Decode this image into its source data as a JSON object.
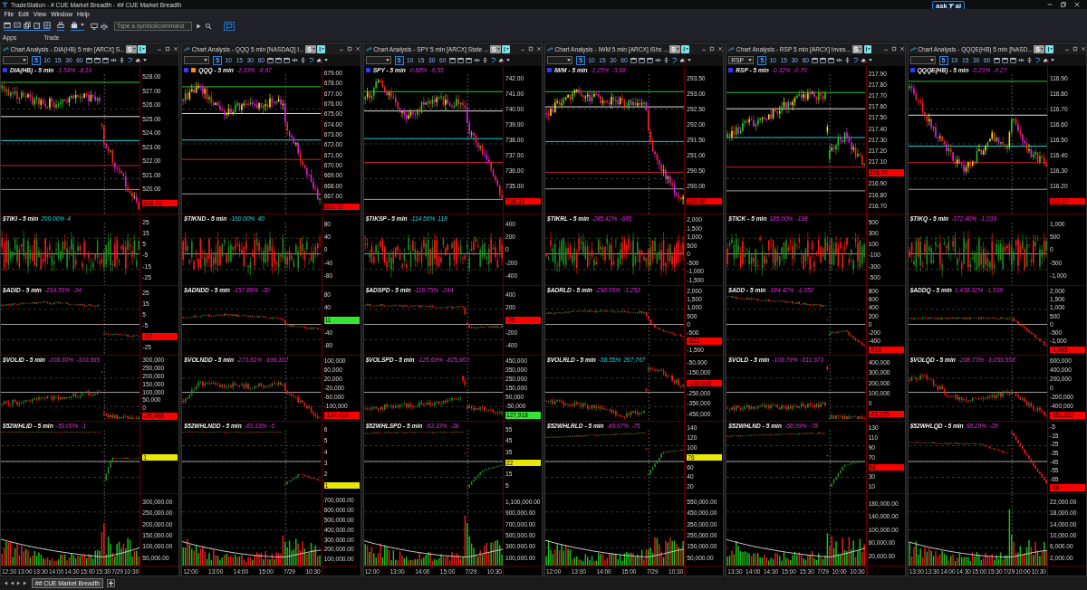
{
  "window": {
    "title": "TradeStation - # CUE Market Breadth - ## CUE Market Breadth"
  },
  "ask_ai": {
    "before": "ask",
    "after": "ai"
  },
  "menu": [
    "File",
    "Edit",
    "View",
    "Window",
    "Help"
  ],
  "toolbar": {
    "command_field": {
      "placeholder": "Type a symbol/command"
    }
  },
  "sections": [
    "Apps",
    "Trade"
  ],
  "panels": [
    {
      "title": "Chart Analysis - DIA(HB) 5 min [ARCX] S...",
      "mode_buttons": [
        {
          "label": "S",
          "active": false
        },
        {
          "label": "I",
          "active": true
        }
      ],
      "intervals": [
        {
          "label": "5",
          "selected": true
        },
        {
          "label": "10",
          "selected": false
        },
        {
          "label": "15",
          "selected": false
        },
        {
          "label": "30",
          "selected": false
        },
        {
          "label": "60",
          "selected": false
        }
      ],
      "panes": [
        {
          "kind": "price",
          "label": "DIA(HB) - 5 min",
          "percent": "-1.54%",
          "change": "-8.10",
          "rising": false,
          "tags": [
            {
              "color": "#2b3bff"
            }
          ],
          "axis": [
            {
              "kind": "tick",
              "text": "528.00"
            },
            {
              "kind": "tick",
              "text": "527.00"
            },
            {
              "kind": "tick",
              "text": "526.00"
            },
            {
              "kind": "tick",
              "text": "525.00"
            },
            {
              "kind": "tick",
              "text": "524.00"
            },
            {
              "kind": "tick",
              "text": "523.00"
            },
            {
              "kind": "tick",
              "text": "522.00"
            },
            {
              "kind": "tick",
              "text": "521.00"
            },
            {
              "kind": "tick",
              "text": "520.00"
            },
            {
              "kind": "marker",
              "text": "518.79",
              "color": "#ff0000"
            }
          ]
        },
        {
          "kind": "tick",
          "label": "$TIKI - 5 min",
          "percent": "200.00%",
          "change": "4",
          "rising": true,
          "axis": [
            {
              "kind": "tick",
              "text": "25"
            },
            {
              "kind": "tick",
              "text": "15"
            },
            {
              "kind": "tick",
              "text": "5"
            },
            {
              "kind": "tick",
              "text": "-5"
            },
            {
              "kind": "tick",
              "text": "-15"
            },
            {
              "kind": "tick",
              "text": "-25"
            }
          ]
        },
        {
          "kind": "breadth",
          "label": "$ADID - 5 min",
          "percent": "-154.55%",
          "change": "-34",
          "rising": false,
          "axis": [
            {
              "kind": "tick",
              "text": "25"
            },
            {
              "kind": "tick",
              "text": "15"
            },
            {
              "kind": "tick",
              "text": "5"
            },
            {
              "kind": "tick",
              "text": "-5"
            },
            {
              "kind": "marker",
              "text": "-12",
              "color": "#ff0000"
            },
            {
              "kind": "tick",
              "text": "-25"
            }
          ]
        },
        {
          "kind": "volume_diff",
          "label": "$VOLID - 5 min",
          "percent": "-108.60%",
          "change": "-333,695",
          "rising": false,
          "axis": [
            {
              "kind": "tick",
              "text": "300,000"
            },
            {
              "kind": "tick",
              "text": "250,000"
            },
            {
              "kind": "tick",
              "text": "200,000"
            },
            {
              "kind": "tick",
              "text": "150,000"
            },
            {
              "kind": "tick",
              "text": "100,000"
            },
            {
              "kind": "tick",
              "text": "50,000"
            },
            {
              "kind": "tick",
              "text": "0"
            },
            {
              "kind": "marker",
              "text": "-20,438",
              "color": "#ff0000"
            }
          ]
        },
        {
          "kind": "highs_lows",
          "label": "$52WHLID - 5 min",
          "percent": "-50.00%",
          "change": "-1",
          "rising": false,
          "axis": [
            {
              "kind": "marker",
              "text": "1",
              "color": "#e8e800"
            }
          ]
        },
        {
          "kind": "volume",
          "axis": [
            {
              "kind": "tick",
              "text": "300,000.00"
            },
            {
              "kind": "tick",
              "text": "250,000.00"
            },
            {
              "kind": "tick",
              "text": "200,000.00"
            },
            {
              "kind": "tick",
              "text": "150,000.00"
            },
            {
              "kind": "tick",
              "text": "100,000.00"
            },
            {
              "kind": "tick",
              "text": "50,000.00"
            }
          ]
        }
      ],
      "time_axis": [
        "12:30",
        "13:00",
        "13:30",
        "14:00",
        "14:30",
        "15:00",
        "15:30",
        "7/29",
        "10:30"
      ]
    },
    {
      "title": "Chart Analysis - QQQ 5 min [NASDAQ] I...",
      "mode_buttons": [
        {
          "label": "S",
          "active": false
        },
        {
          "label": "I",
          "active": true
        }
      ],
      "intervals": [
        {
          "label": "5",
          "selected": true
        },
        {
          "label": "10",
          "selected": false
        },
        {
          "label": "15",
          "selected": false
        },
        {
          "label": "30",
          "selected": false
        },
        {
          "label": "60",
          "selected": false
        }
      ],
      "panes": [
        {
          "kind": "price",
          "label": "QQQ - 5 min",
          "percent": "-1.33%",
          "change": "-8.97",
          "rising": false,
          "tags": [
            {
              "color": "#2b3bff"
            },
            {
              "color": "#ff8a00"
            }
          ],
          "axis": [
            {
              "kind": "tick",
              "text": "679.00"
            },
            {
              "kind": "tick",
              "text": "678.00"
            },
            {
              "kind": "tick",
              "text": "677.00"
            },
            {
              "kind": "tick",
              "text": "676.00"
            },
            {
              "kind": "tick",
              "text": "675.00"
            },
            {
              "kind": "tick",
              "text": "674.00"
            },
            {
              "kind": "tick",
              "text": "673.00"
            },
            {
              "kind": "tick",
              "text": "672.00"
            },
            {
              "kind": "tick",
              "text": "671.00"
            },
            {
              "kind": "tick",
              "text": "670.00"
            },
            {
              "kind": "tick",
              "text": "669.00"
            },
            {
              "kind": "tick",
              "text": "668.00"
            },
            {
              "kind": "tick",
              "text": "667.00"
            },
            {
              "kind": "marker",
              "text": "666.55",
              "color": "#ff0000"
            }
          ]
        },
        {
          "kind": "tick",
          "label": "$TIKND - 5 min",
          "percent": "-160.00%",
          "change": "40",
          "rising": true,
          "axis": [
            {
              "kind": "tick",
              "text": "80"
            },
            {
              "kind": "tick",
              "text": "40"
            },
            {
              "kind": "tick",
              "text": "0"
            },
            {
              "kind": "tick",
              "text": "-40"
            },
            {
              "kind": "tick",
              "text": "-80"
            }
          ]
        },
        {
          "kind": "breadth",
          "label": "$ADNDD - 5 min",
          "percent": "-157.89%",
          "change": "-30",
          "rising": false,
          "axis": [
            {
              "kind": "tick",
              "text": "80"
            },
            {
              "kind": "tick",
              "text": "40"
            },
            {
              "kind": "marker",
              "text": "11",
              "color": "#33e633"
            },
            {
              "kind": "tick",
              "text": "-40"
            },
            {
              "kind": "tick",
              "text": "-80"
            }
          ]
        },
        {
          "kind": "volume_diff",
          "label": "$VOLNDD - 5 min",
          "percent": "-273.61%",
          "change": "-196,102",
          "rising": false,
          "axis": [
            {
              "kind": "tick",
              "text": "100,000"
            },
            {
              "kind": "tick",
              "text": "60,000"
            },
            {
              "kind": "tick",
              "text": "20,000"
            },
            {
              "kind": "tick",
              "text": "-20,000"
            },
            {
              "kind": "tick",
              "text": "-60,000"
            },
            {
              "kind": "tick",
              "text": "-100,000"
            },
            {
              "kind": "marker",
              "text": "-124,418",
              "color": "#ff0000"
            }
          ]
        },
        {
          "kind": "highs_lows",
          "label": "$52WHLNDD - 5 min",
          "percent": "-83.33%",
          "change": "-5",
          "rising": false,
          "axis": [
            {
              "kind": "tick",
              "text": "6"
            },
            {
              "kind": "tick",
              "text": "5"
            },
            {
              "kind": "tick",
              "text": "4"
            },
            {
              "kind": "tick",
              "text": "3"
            },
            {
              "kind": "tick",
              "text": "2"
            },
            {
              "kind": "marker",
              "text": "1",
              "color": "#e8e800"
            }
          ]
        },
        {
          "kind": "volume",
          "axis": [
            {
              "kind": "tick",
              "text": "700,000.00"
            },
            {
              "kind": "tick",
              "text": "600,000.00"
            },
            {
              "kind": "tick",
              "text": "500,000.00"
            },
            {
              "kind": "tick",
              "text": "400,000.00"
            },
            {
              "kind": "tick",
              "text": "300,000.00"
            },
            {
              "kind": "tick",
              "text": "200,000.00"
            },
            {
              "kind": "tick",
              "text": "100,000.00"
            }
          ]
        }
      ],
      "time_axis": [
        "12:00",
        "13:00",
        "14:00",
        "15:00",
        "7/29",
        "10:30"
      ]
    },
    {
      "title": "Chart Analysis - SPY 5 min [ARCX] State ...",
      "mode_buttons": [
        {
          "label": "S",
          "active": false
        },
        {
          "label": "I",
          "active": true
        }
      ],
      "intervals": [
        {
          "label": "5",
          "selected": true
        },
        {
          "label": "10",
          "selected": false
        },
        {
          "label": "15",
          "selected": false
        },
        {
          "label": "30",
          "selected": false
        },
        {
          "label": "60",
          "selected": false
        }
      ],
      "panes": [
        {
          "kind": "price",
          "label": "SPY - 5 min",
          "percent": "-0.88%",
          "change": "-6.55",
          "rising": false,
          "tags": [
            {
              "color": "#2b3bff"
            }
          ],
          "axis": [
            {
              "kind": "tick",
              "text": "742.00"
            },
            {
              "kind": "tick",
              "text": "741.00"
            },
            {
              "kind": "tick",
              "text": "740.00"
            },
            {
              "kind": "tick",
              "text": "739.00"
            },
            {
              "kind": "tick",
              "text": "738.00"
            },
            {
              "kind": "tick",
              "text": "737.00"
            },
            {
              "kind": "tick",
              "text": "736.00"
            },
            {
              "kind": "tick",
              "text": "735.00"
            },
            {
              "kind": "marker",
              "text": "734.31",
              "color": "#ff0000"
            }
          ]
        },
        {
          "kind": "tick",
          "label": "$TIKSP - 5 min",
          "percent": "-114.56%",
          "change": "118",
          "rising": true,
          "axis": [
            {
              "kind": "tick",
              "text": "400"
            },
            {
              "kind": "tick",
              "text": "200"
            },
            {
              "kind": "tick",
              "text": "0"
            },
            {
              "kind": "tick",
              "text": "-200"
            },
            {
              "kind": "tick",
              "text": "-400"
            }
          ]
        },
        {
          "kind": "breadth",
          "label": "$ADSPD - 5 min",
          "percent": "-116.75%",
          "change": "-244",
          "rising": false,
          "axis": [
            {
              "kind": "tick",
              "text": "400"
            },
            {
              "kind": "tick",
              "text": "200"
            },
            {
              "kind": "marker",
              "text": "-35",
              "color": "#ff0000"
            },
            {
              "kind": "tick",
              "text": "-200"
            },
            {
              "kind": "tick",
              "text": "-400"
            }
          ]
        },
        {
          "kind": "volume_diff",
          "label": "$VOLSPD - 5 min",
          "percent": "-125.69%",
          "change": "-825,903",
          "rising": false,
          "axis": [
            {
              "kind": "tick",
              "text": "450,000"
            },
            {
              "kind": "tick",
              "text": "350,000"
            },
            {
              "kind": "tick",
              "text": "250,000"
            },
            {
              "kind": "tick",
              "text": "150,000"
            },
            {
              "kind": "tick",
              "text": "50,000"
            },
            {
              "kind": "tick",
              "text": "-50,000"
            },
            {
              "kind": "marker",
              "text": "127,918",
              "color": "#33e633"
            }
          ]
        },
        {
          "kind": "highs_lows",
          "label": "$52WHLSPD - 5 min",
          "percent": "-63.33%",
          "change": "-38",
          "rising": false,
          "axis": [
            {
              "kind": "tick",
              "text": "55"
            },
            {
              "kind": "tick",
              "text": "45"
            },
            {
              "kind": "tick",
              "text": "35"
            },
            {
              "kind": "marker",
              "text": "22",
              "color": "#e8e800"
            },
            {
              "kind": "tick",
              "text": "15"
            },
            {
              "kind": "tick",
              "text": "5"
            }
          ]
        },
        {
          "kind": "volume",
          "axis": [
            {
              "kind": "tick",
              "text": "1,100,000.00"
            },
            {
              "kind": "tick",
              "text": "900,000.00"
            },
            {
              "kind": "tick",
              "text": "700,000.00"
            },
            {
              "kind": "tick",
              "text": "500,000.00"
            },
            {
              "kind": "tick",
              "text": "300,000.00"
            },
            {
              "kind": "tick",
              "text": "100,000.00"
            }
          ]
        }
      ],
      "time_axis": [
        "12:00",
        "13:00",
        "14:00",
        "15:00",
        "7/29",
        "10:30"
      ]
    },
    {
      "title": "Chart Analysis - IWM 5 min [ARCX] iShs ...",
      "mode_buttons": [
        {
          "label": "S",
          "active": false
        },
        {
          "label": "I",
          "active": true
        }
      ],
      "intervals": [
        {
          "label": "5",
          "selected": true
        },
        {
          "label": "10",
          "selected": false
        },
        {
          "label": "15",
          "selected": false
        },
        {
          "label": "30",
          "selected": false
        },
        {
          "label": "60",
          "selected": false
        }
      ],
      "panes": [
        {
          "kind": "price",
          "label": "IWM - 5 min",
          "percent": "-1.25%",
          "change": "-3.68",
          "rising": false,
          "tags": [
            {
              "color": "#2b3bff"
            }
          ],
          "axis": [
            {
              "kind": "tick",
              "text": "293.50"
            },
            {
              "kind": "tick",
              "text": "293.00"
            },
            {
              "kind": "tick",
              "text": "292.50"
            },
            {
              "kind": "tick",
              "text": "292.00"
            },
            {
              "kind": "tick",
              "text": "291.50"
            },
            {
              "kind": "tick",
              "text": "291.00"
            },
            {
              "kind": "tick",
              "text": "290.50"
            },
            {
              "kind": "tick",
              "text": "290.00"
            },
            {
              "kind": "marker",
              "text": "289.89",
              "color": "#ff0000"
            }
          ]
        },
        {
          "kind": "tick",
          "label": "$TIKRL - 5 min",
          "percent": "-285.42%",
          "change": "-685",
          "rising": false,
          "axis": [
            {
              "kind": "tick",
              "text": "2,000"
            },
            {
              "kind": "tick",
              "text": "1,500"
            },
            {
              "kind": "tick",
              "text": "1,000"
            },
            {
              "kind": "tick",
              "text": "500"
            },
            {
              "kind": "tick",
              "text": "0"
            },
            {
              "kind": "tick",
              "text": "-500"
            },
            {
              "kind": "tick",
              "text": "-1,000"
            },
            {
              "kind": "tick",
              "text": "-1,500"
            }
          ]
        },
        {
          "kind": "breadth",
          "label": "$ADRLD - 5 min",
          "percent": "-290.05%",
          "change": "-1,253",
          "rising": false,
          "axis": [
            {
              "kind": "tick",
              "text": "2,000"
            },
            {
              "kind": "tick",
              "text": "1,500"
            },
            {
              "kind": "tick",
              "text": "1,000"
            },
            {
              "kind": "tick",
              "text": "500"
            },
            {
              "kind": "tick",
              "text": "0"
            },
            {
              "kind": "tick",
              "text": "-500"
            },
            {
              "kind": "marker",
              "text": "-821",
              "color": "#ff0000"
            },
            {
              "kind": "tick",
              "text": "-1,500"
            }
          ]
        },
        {
          "kind": "volume_diff",
          "label": "$VOLRLD - 5 min",
          "percent": "-58.55%",
          "change": "267,767",
          "rising": true,
          "axis": [
            {
              "kind": "tick",
              "text": "-50,000"
            },
            {
              "kind": "tick",
              "text": "-150,000"
            },
            {
              "kind": "marker",
              "text": "-180,505",
              "color": "#ff0000"
            },
            {
              "kind": "tick",
              "text": "-250,000"
            },
            {
              "kind": "tick",
              "text": "-350,000"
            },
            {
              "kind": "tick",
              "text": "-450,000"
            }
          ]
        },
        {
          "kind": "highs_lows",
          "label": "$52WHLRLD - 5 min",
          "percent": "-49.67%",
          "change": "-75",
          "rising": false,
          "axis": [
            {
              "kind": "tick",
              "text": "140"
            },
            {
              "kind": "tick",
              "text": "120"
            },
            {
              "kind": "tick",
              "text": "100"
            },
            {
              "kind": "marker",
              "text": "76",
              "color": "#e8e800"
            },
            {
              "kind": "tick",
              "text": "60"
            },
            {
              "kind": "tick",
              "text": "40"
            },
            {
              "kind": "tick",
              "text": "20"
            }
          ]
        },
        {
          "kind": "volume",
          "axis": [
            {
              "kind": "tick",
              "text": "550,000.00"
            },
            {
              "kind": "tick",
              "text": "450,000.00"
            },
            {
              "kind": "tick",
              "text": "350,000.00"
            },
            {
              "kind": "tick",
              "text": "250,000.00"
            },
            {
              "kind": "tick",
              "text": "150,000.00"
            },
            {
              "kind": "tick",
              "text": "50,000.00"
            }
          ]
        }
      ],
      "time_axis": [
        "12:00",
        "13:00",
        "14:00",
        "15:00",
        "7/29",
        "10:30"
      ]
    },
    {
      "title": "Chart Analysis - RSP 5 min [ARCX] Inves...",
      "symbol_dropdown": {
        "value": "RSP"
      },
      "mode_buttons": [
        {
          "label": "S",
          "active": false
        },
        {
          "label": "I",
          "active": true
        }
      ],
      "intervals": [
        {
          "label": "5",
          "selected": true
        },
        {
          "label": "10",
          "selected": false
        },
        {
          "label": "15",
          "selected": false
        },
        {
          "label": "30",
          "selected": false
        },
        {
          "label": "60",
          "selected": false
        }
      ],
      "panes": [
        {
          "kind": "price",
          "label": "RSP - 5 min",
          "percent": "-0.32%",
          "change": "-0.70",
          "rising": false,
          "tags": [
            {
              "color": "#2b3bff"
            }
          ],
          "axis": [
            {
              "kind": "tick",
              "text": "217.90"
            },
            {
              "kind": "tick",
              "text": "217.80"
            },
            {
              "kind": "tick",
              "text": "217.70"
            },
            {
              "kind": "tick",
              "text": "217.60"
            },
            {
              "kind": "tick",
              "text": "217.50"
            },
            {
              "kind": "tick",
              "text": "217.40"
            },
            {
              "kind": "tick",
              "text": "217.30"
            },
            {
              "kind": "tick",
              "text": "217.20"
            },
            {
              "kind": "tick",
              "text": "217.10"
            },
            {
              "kind": "marker",
              "text": "216.95",
              "color": "#ff0000"
            },
            {
              "kind": "tick",
              "text": "216.90"
            },
            {
              "kind": "tick",
              "text": "216.80"
            },
            {
              "kind": "tick",
              "text": "216.70"
            }
          ]
        },
        {
          "kind": "tick",
          "label": "$TICK - 5 min",
          "percent": "185.00%",
          "change": "-198",
          "rising": false,
          "axis": [
            {
              "kind": "tick",
              "text": "500"
            },
            {
              "kind": "tick",
              "text": "300"
            },
            {
              "kind": "tick",
              "text": "100"
            },
            {
              "kind": "tick",
              "text": "-100"
            },
            {
              "kind": "tick",
              "text": "-300"
            },
            {
              "kind": "tick",
              "text": "-500"
            }
          ]
        },
        {
          "kind": "breadth",
          "label": "$ADD - 5 min",
          "percent": "-184.42%",
          "change": "-1,350",
          "rising": false,
          "axis": [
            {
              "kind": "tick",
              "text": "800"
            },
            {
              "kind": "tick",
              "text": "600"
            },
            {
              "kind": "tick",
              "text": "400"
            },
            {
              "kind": "tick",
              "text": "200"
            },
            {
              "kind": "tick",
              "text": "0"
            },
            {
              "kind": "tick",
              "text": "-200"
            },
            {
              "kind": "tick",
              "text": "-400"
            },
            {
              "kind": "marker",
              "text": "-518",
              "color": "#ff0000"
            }
          ]
        },
        {
          "kind": "volume_diff",
          "label": "$VOLD - 5 min",
          "percent": "-108.79%",
          "change": "-511,673",
          "rising": false,
          "axis": [
            {
              "kind": "tick",
              "text": "400,000"
            },
            {
              "kind": "tick",
              "text": "300,000"
            },
            {
              "kind": "tick",
              "text": "200,000"
            },
            {
              "kind": "tick",
              "text": "100,000"
            },
            {
              "kind": "tick",
              "text": "0"
            },
            {
              "kind": "marker",
              "text": "-41,129",
              "color": "#ff0000"
            }
          ]
        },
        {
          "kind": "highs_lows",
          "label": "$52WHLND - 5 min",
          "percent": "-58.09%",
          "change": "-78",
          "rising": false,
          "axis": [
            {
              "kind": "tick",
              "text": "130"
            },
            {
              "kind": "tick",
              "text": "110"
            },
            {
              "kind": "tick",
              "text": "90"
            },
            {
              "kind": "tick",
              "text": "70"
            },
            {
              "kind": "marker",
              "text": "54",
              "color": "#ff0000"
            },
            {
              "kind": "tick",
              "text": "30"
            },
            {
              "kind": "tick",
              "text": "10"
            }
          ]
        },
        {
          "kind": "volume",
          "axis": [
            {
              "kind": "tick",
              "text": "180,000.00"
            },
            {
              "kind": "tick",
              "text": "140,000.00"
            },
            {
              "kind": "tick",
              "text": "100,000.00"
            },
            {
              "kind": "tick",
              "text": "60,000.00"
            },
            {
              "kind": "tick",
              "text": "20,000.00"
            }
          ]
        }
      ],
      "time_axis": [
        "13:30",
        "14:00",
        "14:30",
        "15:00",
        "15:30",
        "7/29",
        "10:00",
        "10:30"
      ]
    },
    {
      "title": "Chart Analysis - QQQE(HB) 5 min [NASD...",
      "mode_buttons": [
        {
          "label": "S",
          "active": false
        },
        {
          "label": "I",
          "active": true
        }
      ],
      "intervals": [
        {
          "label": "5",
          "selected": true
        },
        {
          "label": "10",
          "selected": false
        },
        {
          "label": "15",
          "selected": false
        },
        {
          "label": "30",
          "selected": false
        },
        {
          "label": "60",
          "selected": false
        }
      ],
      "panes": [
        {
          "kind": "price",
          "label": "QQQE(HB) - 5 min",
          "percent": "-0.23%",
          "change": "-0.27",
          "rising": false,
          "tags": [
            {
              "color": "#2b3bff"
            }
          ],
          "axis": [
            {
              "kind": "tick",
              "text": "116.90"
            },
            {
              "kind": "tick",
              "text": "116.80"
            },
            {
              "kind": "tick",
              "text": "116.70"
            },
            {
              "kind": "tick",
              "text": "116.60"
            },
            {
              "kind": "tick",
              "text": "116.50"
            },
            {
              "kind": "tick",
              "text": "116.40"
            },
            {
              "kind": "tick",
              "text": "116.30"
            },
            {
              "kind": "tick",
              "text": "116.20"
            },
            {
              "kind": "marker",
              "text": "116.17",
              "color": "#ff0000"
            }
          ]
        },
        {
          "kind": "tick",
          "label": "$TIKQ - 5 min",
          "percent": "-372.40%",
          "change": "-1,039",
          "rising": false,
          "axis": [
            {
              "kind": "tick",
              "text": "1,000"
            },
            {
              "kind": "tick",
              "text": "500"
            },
            {
              "kind": "tick",
              "text": "0"
            },
            {
              "kind": "tick",
              "text": "-500"
            },
            {
              "kind": "tick",
              "text": "-1,000"
            }
          ]
        },
        {
          "kind": "breadth",
          "label": "$ADDQ - 5 min",
          "percent": "1,438.32%",
          "change": "-1,539",
          "rising": false,
          "axis": [
            {
              "kind": "tick",
              "text": "2,000"
            },
            {
              "kind": "tick",
              "text": "1,500"
            },
            {
              "kind": "tick",
              "text": "1,000"
            },
            {
              "kind": "tick",
              "text": "500"
            },
            {
              "kind": "tick",
              "text": "0"
            },
            {
              "kind": "tick",
              "text": "-500"
            },
            {
              "kind": "tick",
              "text": "-1,000"
            },
            {
              "kind": "marker",
              "text": "-1,045",
              "color": "#ff0000"
            }
          ]
        },
        {
          "kind": "volume_diff",
          "label": "$VOLQD - 5 min",
          "percent": "-208.73%",
          "change": "-1,059,558",
          "rising": false,
          "axis": [
            {
              "kind": "tick",
              "text": "600,000"
            },
            {
              "kind": "tick",
              "text": "400,000"
            },
            {
              "kind": "tick",
              "text": "200,000"
            },
            {
              "kind": "tick",
              "text": "0"
            },
            {
              "kind": "tick",
              "text": "-200,000"
            },
            {
              "kind": "tick",
              "text": "-400,000"
            },
            {
              "kind": "marker",
              "text": "-551,827",
              "color": "#ff0000"
            }
          ]
        },
        {
          "kind": "highs_lows",
          "label": "$52WHLQD - 5 min",
          "percent": "68.29%",
          "change": "-28",
          "rising": false,
          "axis": [
            {
              "kind": "tick",
              "text": "-5"
            },
            {
              "kind": "tick",
              "text": "-15"
            },
            {
              "kind": "tick",
              "text": "-25"
            },
            {
              "kind": "tick",
              "text": "-35"
            },
            {
              "kind": "tick",
              "text": "-45"
            },
            {
              "kind": "tick",
              "text": "-55"
            },
            {
              "kind": "tick",
              "text": "-65"
            },
            {
              "kind": "marker",
              "text": "-68",
              "color": "#ff0000"
            }
          ]
        },
        {
          "kind": "volume",
          "axis": [
            {
              "kind": "tick",
              "text": "22,000.00"
            },
            {
              "kind": "tick",
              "text": "18,000.00"
            },
            {
              "kind": "tick",
              "text": "14,000.00"
            },
            {
              "kind": "tick",
              "text": "10,000.00"
            },
            {
              "kind": "tick",
              "text": "6,000.00"
            },
            {
              "kind": "tick",
              "text": "2,000.00"
            }
          ]
        }
      ],
      "time_axis": [
        "13:00",
        "13:30",
        "14:00",
        "14:30",
        "15:00",
        "15:30",
        "7/29",
        "10:00",
        "10:30"
      ]
    }
  ],
  "tabs": [
    {
      "label": "## CUE Market Breadth",
      "selected": true
    }
  ]
}
